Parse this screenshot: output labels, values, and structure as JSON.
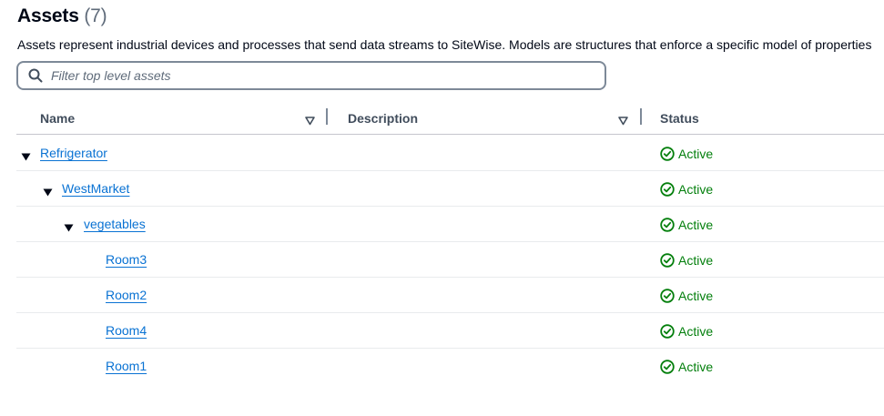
{
  "header": {
    "title": "Assets",
    "count": "(7)",
    "description": "Assets represent industrial devices and processes that send data streams to SiteWise. Models are structures that enforce a specific model of properties"
  },
  "search": {
    "placeholder": "Filter top level assets",
    "value": "",
    "icon": "search-icon"
  },
  "table": {
    "columns": [
      {
        "label": "Name"
      },
      {
        "label": "Description"
      },
      {
        "label": "Status"
      }
    ],
    "rows": [
      {
        "name": "Refrigerator",
        "level": 0,
        "expanded": true,
        "description": "",
        "status": "Active"
      },
      {
        "name": "WestMarket",
        "level": 1,
        "expanded": true,
        "description": "",
        "status": "Active"
      },
      {
        "name": "vegetables",
        "level": 2,
        "expanded": true,
        "description": "",
        "status": "Active"
      },
      {
        "name": "Room3",
        "level": 3,
        "expanded": false,
        "description": "",
        "status": "Active"
      },
      {
        "name": "Room2",
        "level": 3,
        "expanded": false,
        "description": "",
        "status": "Active"
      },
      {
        "name": "Room4",
        "level": 3,
        "expanded": false,
        "description": "",
        "status": "Active"
      },
      {
        "name": "Room1",
        "level": 3,
        "expanded": false,
        "description": "",
        "status": "Active"
      }
    ]
  },
  "colors": {
    "link": "#0972d3",
    "status_active": "#037f0c",
    "text": "#000716"
  }
}
